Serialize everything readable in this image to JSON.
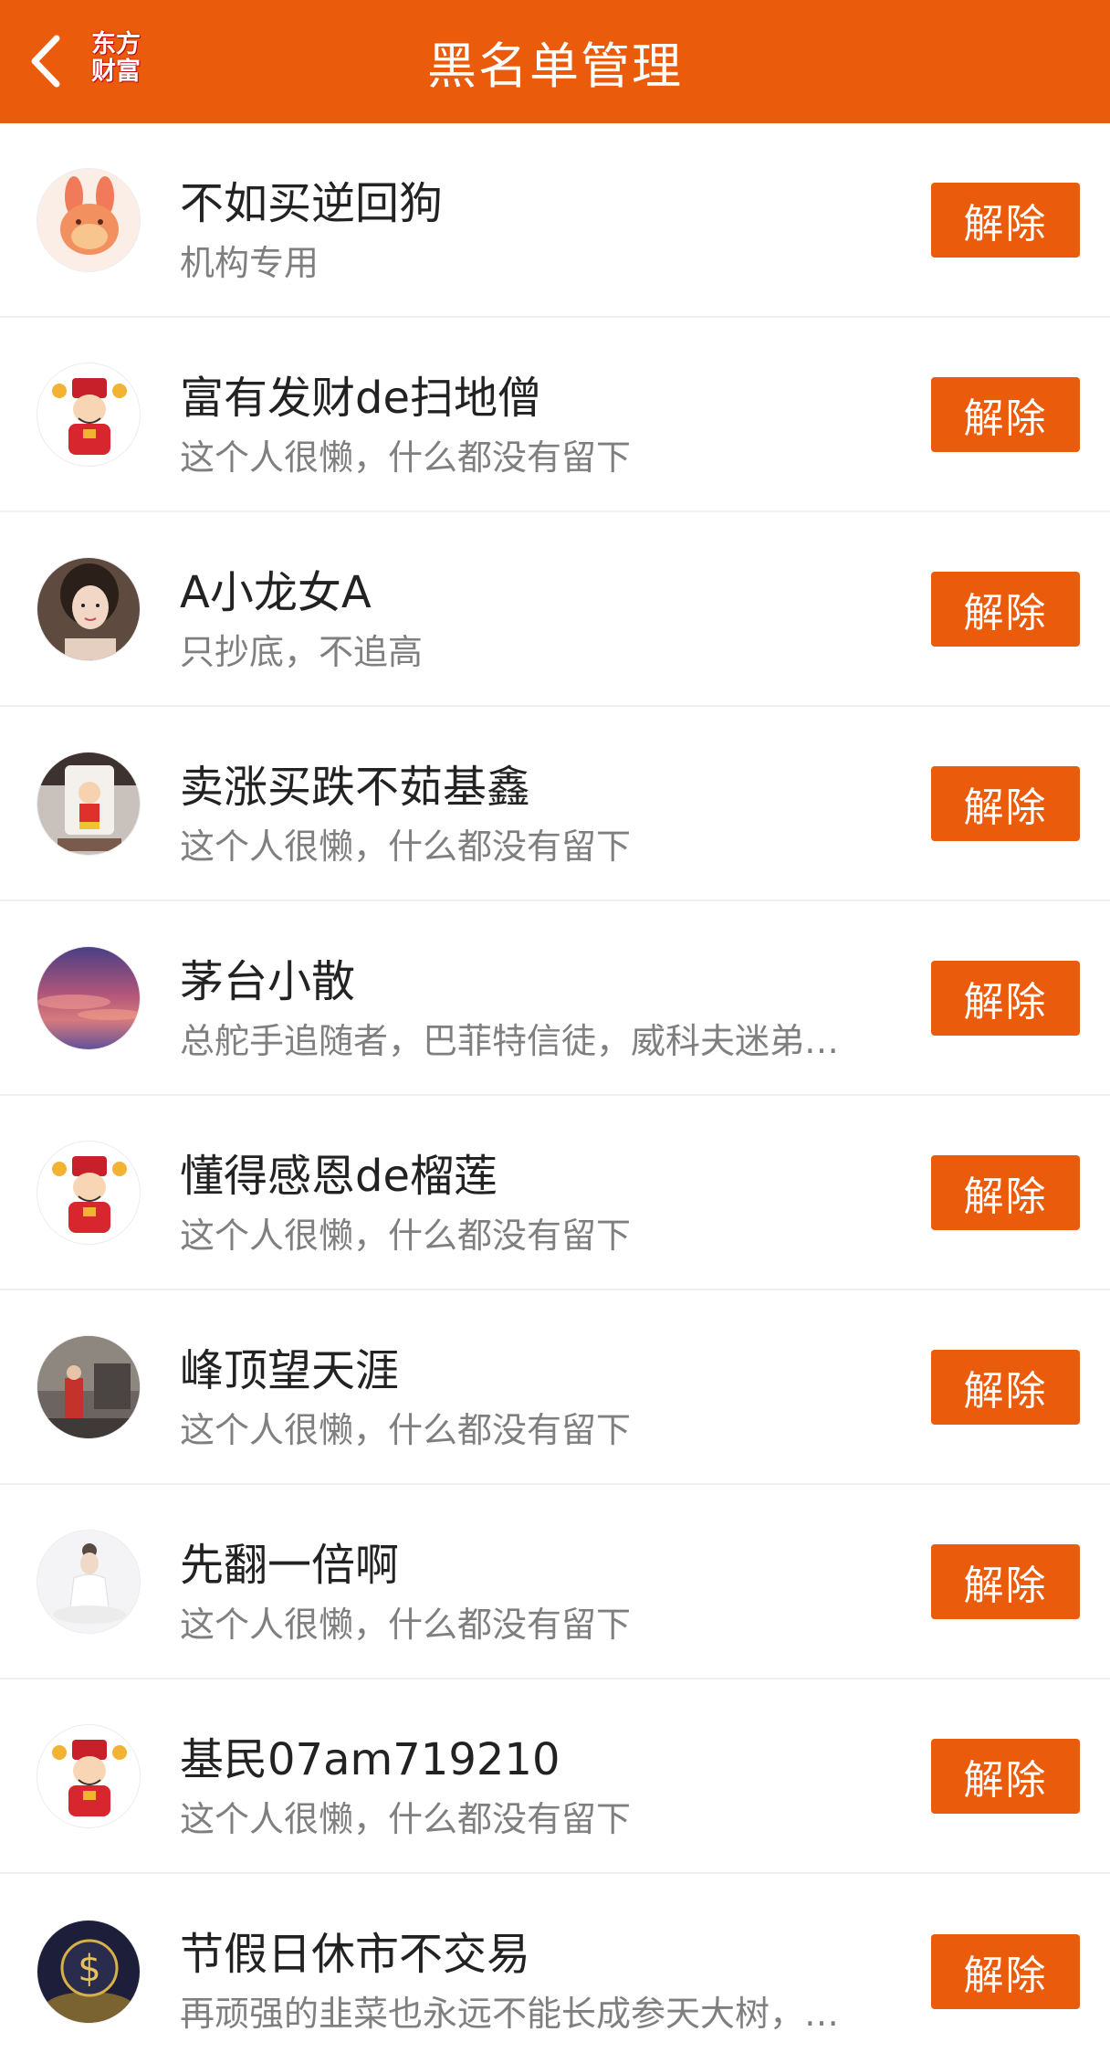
{
  "header": {
    "title": "黑名单管理",
    "logo_line1": "东方",
    "logo_line2": "财富",
    "back_icon": "chevron-left-icon"
  },
  "colors": {
    "accent": "#ea5b0c",
    "name_text": "#222222",
    "sub_text": "#7f7f7f"
  },
  "list": {
    "items": [
      {
        "name": "不如买逆回狗",
        "desc": "机构专用",
        "button": "解除",
        "avatar": "rabbit-avatar"
      },
      {
        "name": "富有发财de扫地僧",
        "desc": "这个人很懒，什么都没有留下",
        "button": "解除",
        "avatar": "god-of-wealth-avatar"
      },
      {
        "name": "A小龙女A",
        "desc": "只抄底，不追高",
        "button": "解除",
        "avatar": "woman-photo-avatar"
      },
      {
        "name": "卖涨买跌不茹基鑫",
        "desc": "这个人很懒，什么都没有留下",
        "button": "解除",
        "avatar": "cartoon-cup-avatar"
      },
      {
        "name": "茅台小散",
        "desc": "总舵手追随者，巴菲特信徒，威科夫迷弟…",
        "button": "解除",
        "avatar": "sunset-sky-avatar"
      },
      {
        "name": "懂得感恩de榴莲",
        "desc": "这个人很懒，什么都没有留下",
        "button": "解除",
        "avatar": "god-of-wealth-avatar"
      },
      {
        "name": "峰顶望天涯",
        "desc": "这个人很懒，什么都没有留下",
        "button": "解除",
        "avatar": "street-photo-avatar"
      },
      {
        "name": "先翻一倍啊",
        "desc": "这个人很懒，什么都没有留下",
        "button": "解除",
        "avatar": "meditation-avatar"
      },
      {
        "name": "基民07am719210",
        "desc": "这个人很懒，什么都没有留下",
        "button": "解除",
        "avatar": "god-of-wealth-avatar"
      },
      {
        "name": "节假日休市不交易",
        "desc": "再顽强的韭菜也永远不能长成参天大树，…",
        "button": "解除",
        "avatar": "dollar-sign-avatar"
      }
    ]
  }
}
